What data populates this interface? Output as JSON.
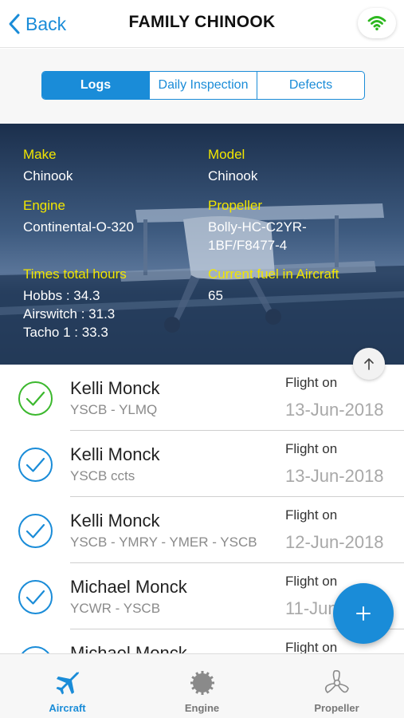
{
  "header": {
    "back_label": "Back",
    "title": "FAMILY CHINOOK",
    "wifi_icon": "wifi-icon",
    "wifi_color": "#2db81f"
  },
  "segments": [
    "Logs",
    "Daily Inspection",
    "Defects"
  ],
  "active_segment": "Logs",
  "aircraft": {
    "make_label": "Make",
    "make": "Chinook",
    "model_label": "Model",
    "model": "Chinook",
    "engine_label": "Engine",
    "engine": "Continental-O-320",
    "propeller_label": "Propeller",
    "propeller_line1": "Bolly-HC-C2YR-",
    "propeller_line2": "1BF/F8477-4",
    "times_label": "Times total hours",
    "hobbs": "Hobbs : 34.3",
    "airswitch": "Airswitch : 31.3",
    "tacho": "Tacho 1 : 33.3",
    "fuel_label": "Current fuel in Aircraft",
    "fuel": "65"
  },
  "logs": [
    {
      "pilot": "Kelli Monck",
      "route": "YSCB - YLMQ",
      "flight_label": "Flight on",
      "date": "13-Jun-2018",
      "status": "complete",
      "check_color": "#3cb82e"
    },
    {
      "pilot": "Kelli Monck",
      "route": "YSCB ccts",
      "flight_label": "Flight on",
      "date": "13-Jun-2018",
      "status": "complete",
      "check_color": "#1a8cd8"
    },
    {
      "pilot": "Kelli Monck",
      "route": "YSCB - YMRY - YMER - YSCB",
      "flight_label": "Flight on",
      "date": "12-Jun-2018",
      "status": "complete",
      "check_color": "#1a8cd8"
    },
    {
      "pilot": "Michael Monck",
      "route": "YCWR - YSCB",
      "flight_label": "Flight on",
      "date": "11-Jun-2018",
      "status": "complete",
      "check_color": "#1a8cd8"
    },
    {
      "pilot": "Michael Monck",
      "route": "",
      "flight_label": "Flight on",
      "date": "",
      "status": "complete",
      "check_color": "#1a8cd8"
    }
  ],
  "tabs": [
    {
      "label": "Aircraft",
      "icon": "airplane-icon"
    },
    {
      "label": "Engine",
      "icon": "engine-gear-icon"
    },
    {
      "label": "Propeller",
      "icon": "propeller-icon"
    }
  ],
  "active_tab": "Aircraft",
  "colors": {
    "accent": "#1a8cd8",
    "label_yellow": "#f2e600"
  }
}
